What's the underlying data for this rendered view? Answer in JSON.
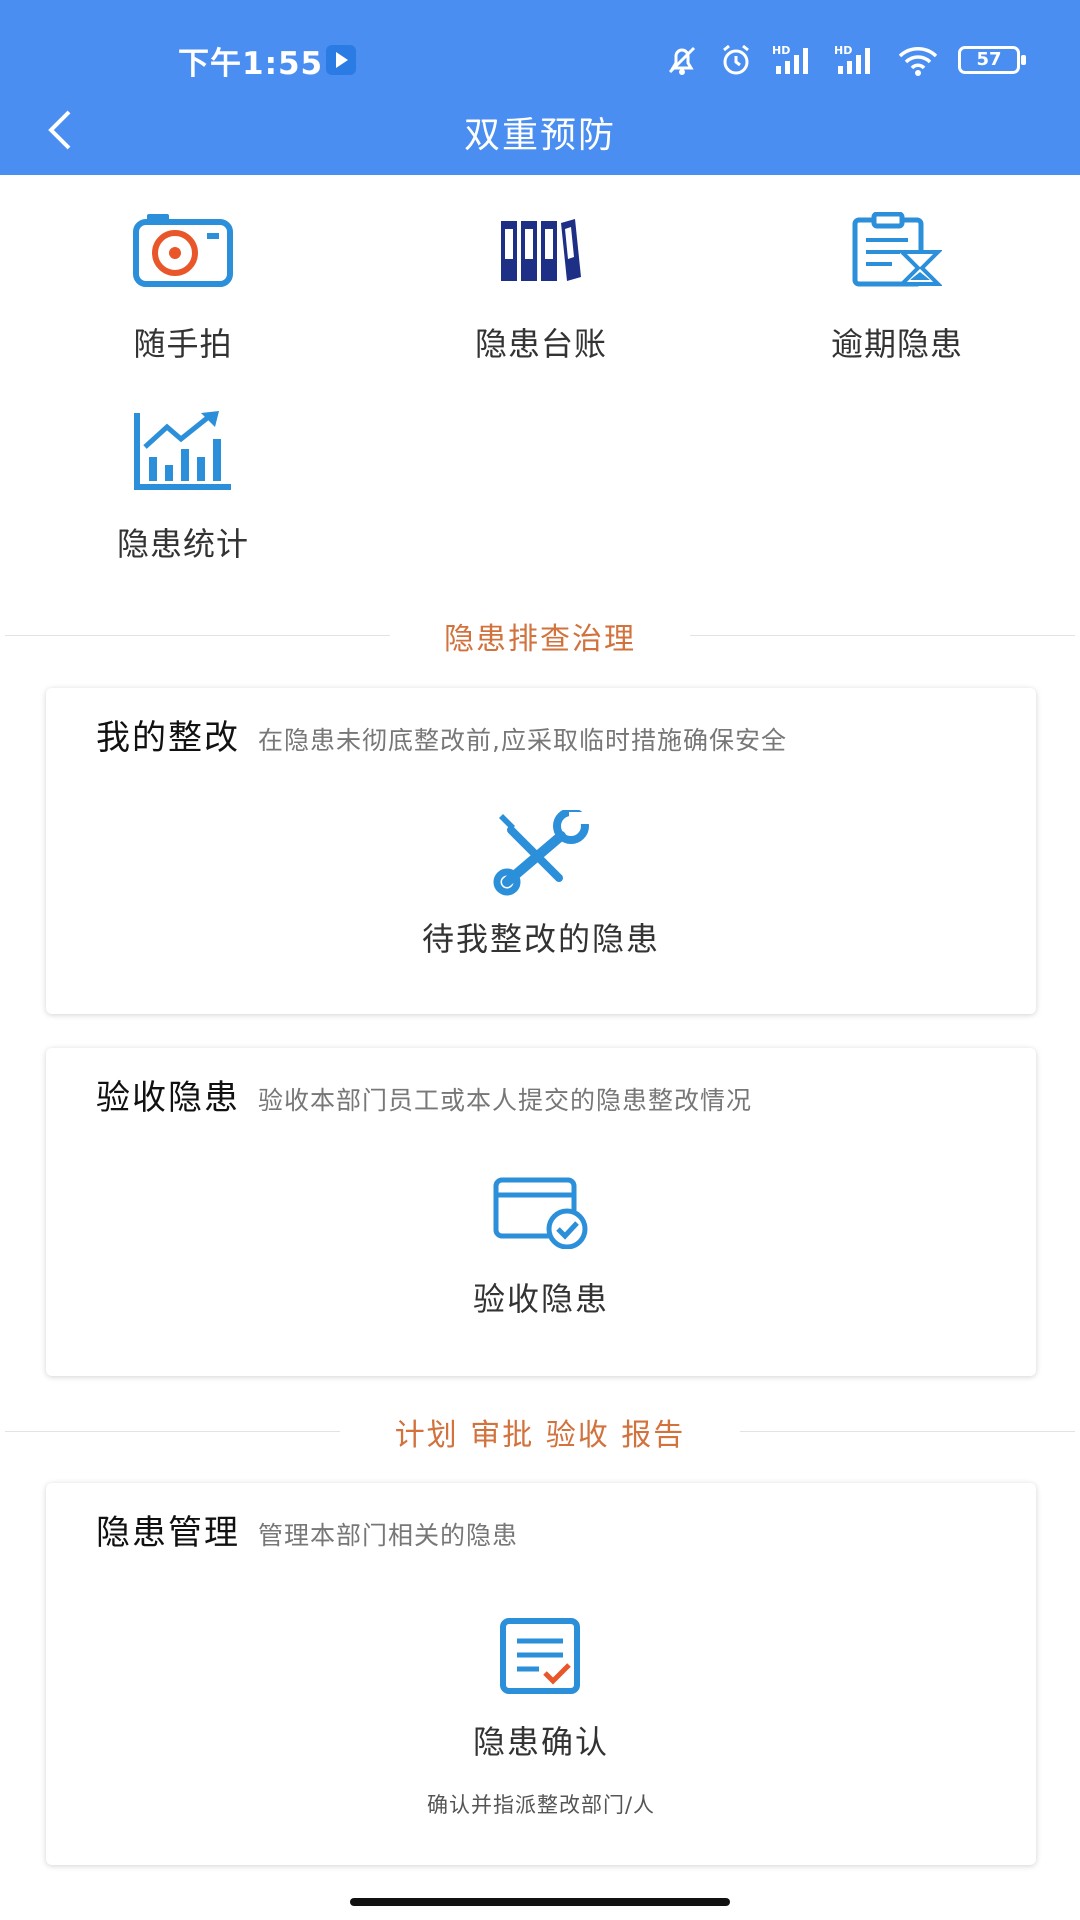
{
  "status_bar": {
    "time": "下午1:55",
    "battery": "57"
  },
  "header": {
    "title": "双重预防"
  },
  "quick_items": [
    {
      "label": "随手拍",
      "icon": "camera-icon"
    },
    {
      "label": "隐患台账",
      "icon": "ledger-books-icon"
    },
    {
      "label": "逾期隐患",
      "icon": "clipboard-hourglass-icon"
    },
    {
      "label": "隐患统计",
      "icon": "bar-chart-trend-icon"
    }
  ],
  "sections": {
    "inspection": "隐患排查治理",
    "workflow": "计划 审批 验收 报告"
  },
  "cards": {
    "rectify": {
      "title": "我的整改",
      "desc": "在隐患未彻底整改前,应采取临时措施确保安全",
      "action": "待我整改的隐患",
      "icon": "wrench-screwdriver-icon"
    },
    "accept": {
      "title": "验收隐患",
      "desc": "验收本部门员工或本人提交的隐患整改情况",
      "action": "验收隐患",
      "icon": "card-check-icon"
    },
    "manage": {
      "title": "隐患管理",
      "desc": "管理本部门相关的隐患",
      "action": "隐患确认",
      "sub": "确认并指派整改部门/人",
      "icon": "document-check-icon"
    }
  },
  "colors": {
    "header_bg": "#4b8ef2",
    "accent_orange": "#d2723d",
    "icon_blue": "#2b8fd9",
    "icon_navy": "#1e2f86",
    "icon_red": "#e8562a"
  }
}
